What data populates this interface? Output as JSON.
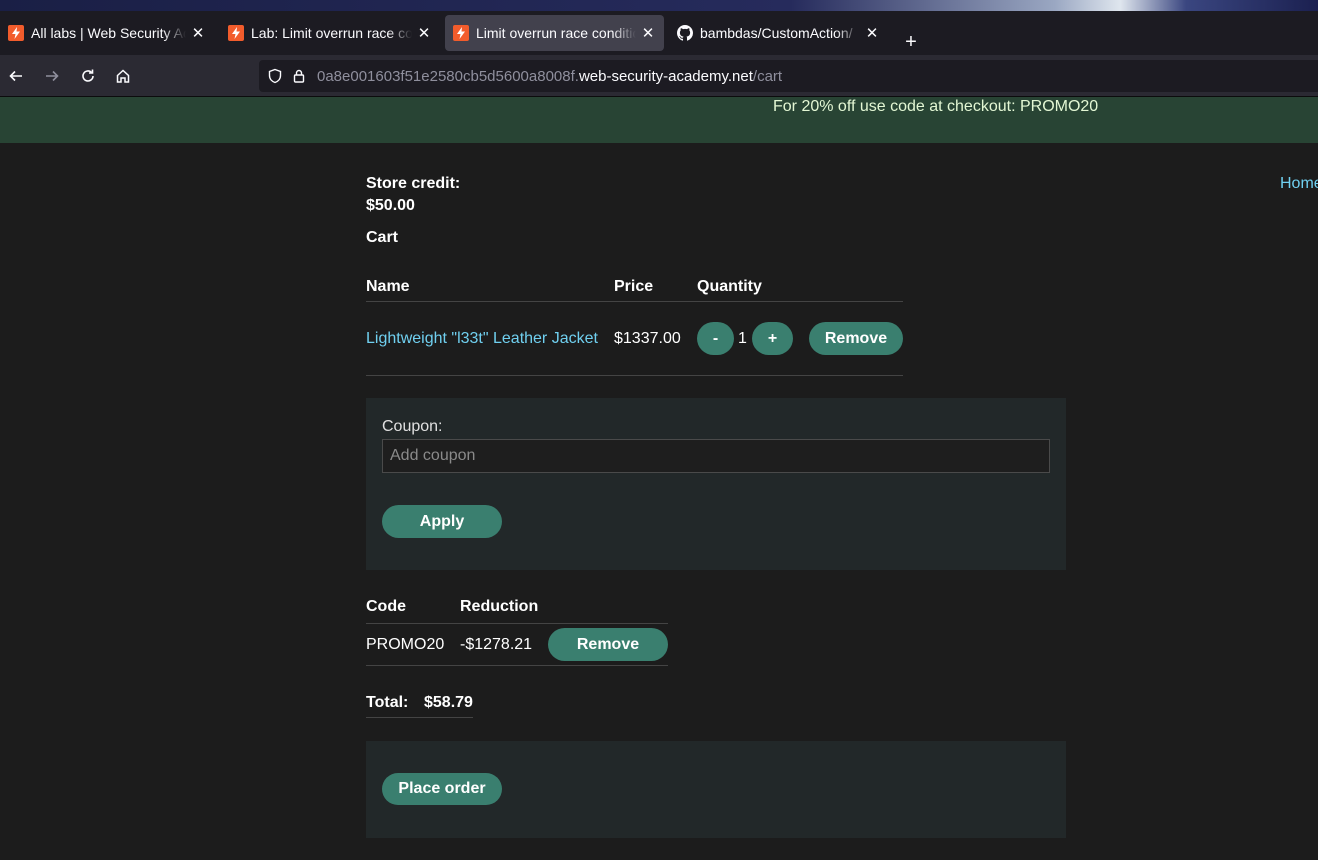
{
  "browser": {
    "tabs": [
      {
        "title": "All labs | Web Security Academy",
        "active": false,
        "icon": "portswigger-icon"
      },
      {
        "title": "Lab: Limit overrun race conditions",
        "active": false,
        "icon": "portswigger-icon"
      },
      {
        "title": "Limit overrun race conditions",
        "active": true,
        "icon": "portswigger-icon"
      },
      {
        "title": "bambdas/CustomAction/",
        "active": false,
        "icon": "github-icon"
      }
    ],
    "close_glyph": "✕",
    "new_tab_glyph": "+",
    "url": {
      "prefix": "0a8e001603f51e2580cb5d5600a8008f.",
      "host": "web-security-academy.net",
      "path": "/cart"
    }
  },
  "page": {
    "promo_banner": "For 20% off use code at checkout: PROMO20",
    "home_link": "Home",
    "store_credit_label": "Store credit:",
    "store_credit_value": "$50.00",
    "cart_heading": "Cart",
    "cart_table": {
      "headers": {
        "name": "Name",
        "price": "Price",
        "quantity": "Quantity"
      },
      "rows": [
        {
          "name": "Lightweight \"l33t\" Leather Jacket",
          "price": "$1337.00",
          "quantity": "1",
          "minus_label": "-",
          "plus_label": "+",
          "remove_label": "Remove"
        }
      ]
    },
    "coupon": {
      "label": "Coupon:",
      "placeholder": "Add coupon",
      "value": "",
      "apply_label": "Apply"
    },
    "reduction_table": {
      "headers": {
        "code": "Code",
        "reduction": "Reduction"
      },
      "rows": [
        {
          "code": "PROMO20",
          "reduction": "-$1278.21",
          "remove_label": "Remove"
        }
      ]
    },
    "total_label": "Total:",
    "total_value": "$58.79",
    "place_order_label": "Place order"
  },
  "colors": {
    "accent_button": "#3a7f6f",
    "link": "#70d0f0",
    "banner_bg": "#284434",
    "page_bg": "#1c1c1c"
  }
}
